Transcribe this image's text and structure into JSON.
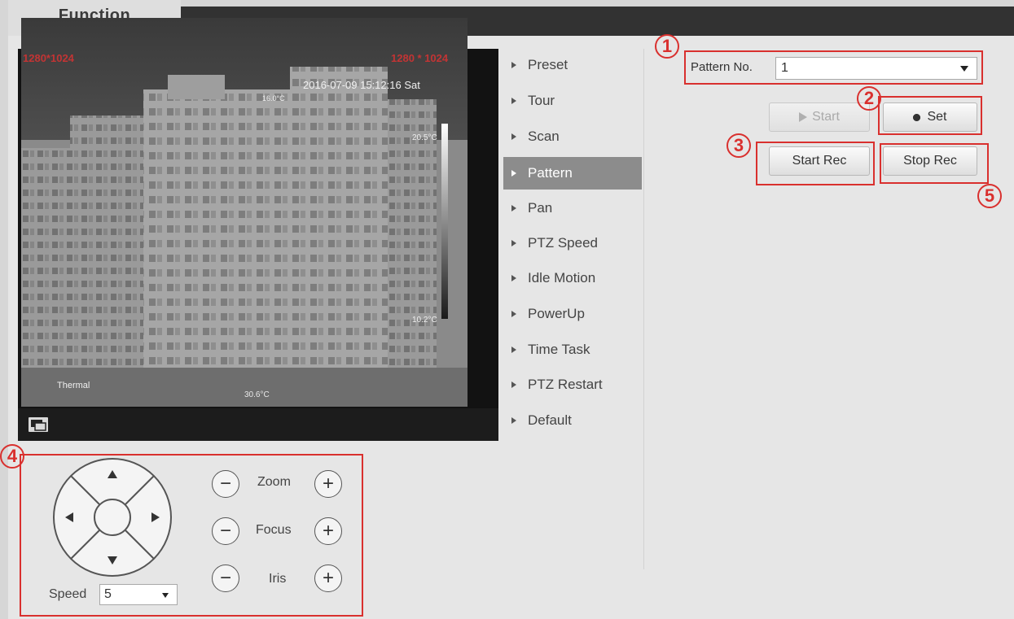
{
  "header": {
    "tab_label": "Function"
  },
  "video": {
    "overlay_top_left": "1280*1024",
    "overlay_top_right": "1280 * 1024",
    "timestamp": "2016-07-09 15:12:16 Sat",
    "temp_marker": "16.0°C",
    "scale_top": "20.5°C",
    "scale_bottom": "10.2°C",
    "channel_label": "Thermal",
    "center_marker": "30.6°C"
  },
  "menu": {
    "items": [
      {
        "label": "Preset"
      },
      {
        "label": "Tour"
      },
      {
        "label": "Scan"
      },
      {
        "label": "Pattern",
        "active": true
      },
      {
        "label": "Pan"
      },
      {
        "label": "PTZ Speed"
      },
      {
        "label": "Idle Motion"
      },
      {
        "label": "PowerUp"
      },
      {
        "label": "Time Task"
      },
      {
        "label": "PTZ Restart"
      },
      {
        "label": "Default"
      }
    ]
  },
  "pattern": {
    "label": "Pattern No.",
    "value": "1",
    "start_label": "Start",
    "set_label": "Set",
    "start_rec_label": "Start Rec",
    "stop_rec_label": "Stop Rec"
  },
  "ptz": {
    "zoom_label": "Zoom",
    "focus_label": "Focus",
    "iris_label": "Iris",
    "speed_label": "Speed",
    "speed_value": "5"
  },
  "callouts": {
    "n1": "1",
    "n2": "2",
    "n3": "3",
    "n4": "4",
    "n5": "5"
  },
  "colors": {
    "callout_red": "#d9302e",
    "topbar": "#323232",
    "active_menu": "#8c8c8c"
  }
}
